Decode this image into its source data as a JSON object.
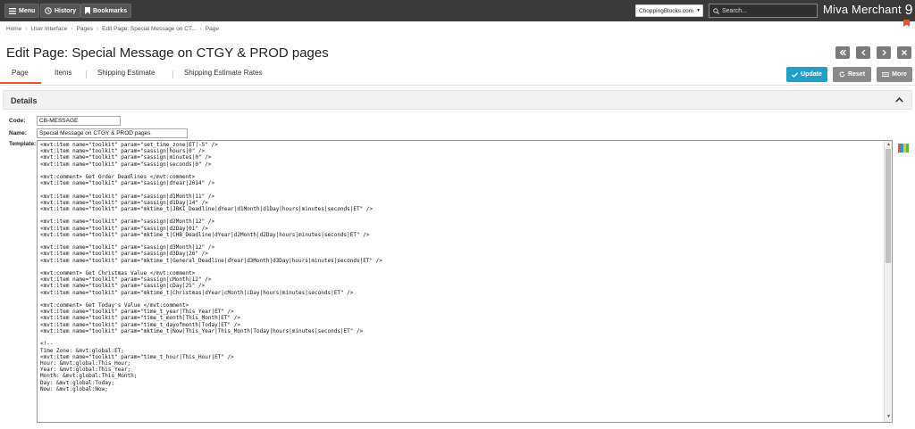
{
  "topbar": {
    "menu_label": "Menu",
    "history_label": "History",
    "bookmarks_label": "Bookmarks",
    "store_name": "ChoppingBlocks.com",
    "search_placeholder": "Search...",
    "brand": "Miva Merchant",
    "brand_number": "9"
  },
  "breadcrumb": [
    "Home",
    "User Interface",
    "Pages",
    "Edit Page: Special Message on CT...",
    "Page"
  ],
  "page": {
    "title": "Edit Page: Special Message on CTGY & PROD pages"
  },
  "tabs": [
    "Page",
    "Items",
    "Shipping Estimate",
    "Shipping Estimate Rates"
  ],
  "actions": {
    "update": "Update",
    "reset": "Reset",
    "more": "More"
  },
  "details": {
    "title": "Details",
    "code_label": "Code:",
    "code_value": "CB-MESSAGE",
    "name_label": "Name:",
    "name_value": "Special Message on CTGY & PROD pages",
    "template_label": "Template:"
  },
  "template_code": [
    "<mvt:item name=\"toolkit\" param=\"set_time_zone|ET|-5\" />",
    "<mvt:item name=\"toolkit\" param=\"sassign|hours|0\" />",
    "<mvt:item name=\"toolkit\" param=\"sassign|minutes|0\" />",
    "<mvt:item name=\"toolkit\" param=\"sassign|seconds|0\" />",
    "",
    "<mvt:comment> Get Order Deadlines </mvt:comment>",
    "<mvt:item name=\"toolkit\" param=\"sassign|dYear|2014\" />",
    "",
    "<mvt:item name=\"toolkit\" param=\"sassign|d1Month|11\" />",
    "<mvt:item name=\"toolkit\" param=\"sassign|d1Day|14\" />",
    "<mvt:item name=\"toolkit\" param=\"mktime_t|JBKI_Deadline|dYear|d1Month|d1Day|hours|minutes|seconds|ET\" />",
    "",
    "<mvt:item name=\"toolkit\" param=\"sassign|d2Month|12\" />",
    "<mvt:item name=\"toolkit\" param=\"sassign|d2Day|01\" />",
    "<mvt:item name=\"toolkit\" param=\"mktime_t|CHB_Deadline|dYear|d2Month|d2Day|hours|minutes|seconds|ET\" />",
    "",
    "<mvt:item name=\"toolkit\" param=\"sassign|d3Month|12\" />",
    "<mvt:item name=\"toolkit\" param=\"sassign|d3Day|26\" />",
    "<mvt:item name=\"toolkit\" param=\"mktime_t|General_Deadline|dYear|d3Month|d3Day|hours|minutes|seconds|ET\" />",
    "",
    "<mvt:comment> Get Christmas Value </mvt:comment>",
    "<mvt:item name=\"toolkit\" param=\"sassign|cMonth|12\" />",
    "<mvt:item name=\"toolkit\" param=\"sassign|cDay|25\" />",
    "<mvt:item name=\"toolkit\" param=\"mktime_t|Christmas|dYear|cMonth|cDay|hours|minutes|seconds|ET\" />",
    "",
    "<mvt:comment> Get Today's Value </mvt:comment>",
    "<mvt:item name=\"toolkit\" param=\"time_t_year|This_Year|ET\" />",
    "<mvt:item name=\"toolkit\" param=\"time_t_month|This_Month|ET\" />",
    "<mvt:item name=\"toolkit\" param=\"time_t_dayofmonth|Today|ET\" />",
    "<mvt:item name=\"toolkit\" param=\"mktime_t|Now|This_Year|This_Month|Today|hours|minutes|seconds|ET\" />",
    "",
    "<!--",
    "Time Zone: &mvt:global:ET;",
    "<mvt:item name=\"toolkit\" param=\"time_t_hour|This_Hour|ET\" />",
    "Hour: &mvt:global:This_Hour;",
    "Year: &mvt:global:This_Year;",
    "Month: &mvt:global:This_Month;",
    "Day: &mvt:global:Today;",
    "Now: &mvt:global:Now;"
  ],
  "colors": {
    "topbar": "#3a3a3a",
    "accent_orange": "#e8542e",
    "update_button": "#1fa0c9",
    "reset_button": "#8a8a8a",
    "more_button": "#8a8a8a",
    "nav_button": "#7a7a7a"
  },
  "icons": {
    "menu": "hamburger-icon",
    "history": "clock-icon",
    "bookmarks": "bookmark-icon",
    "search": "search-icon",
    "first": "first-page-icon",
    "prev": "previous-icon",
    "next": "next-icon",
    "close": "close-icon",
    "update": "check-icon",
    "reset": "reset-icon",
    "more": "more-icon",
    "collapse": "chevron-up-icon",
    "template_tool": "color-palette-icon"
  }
}
